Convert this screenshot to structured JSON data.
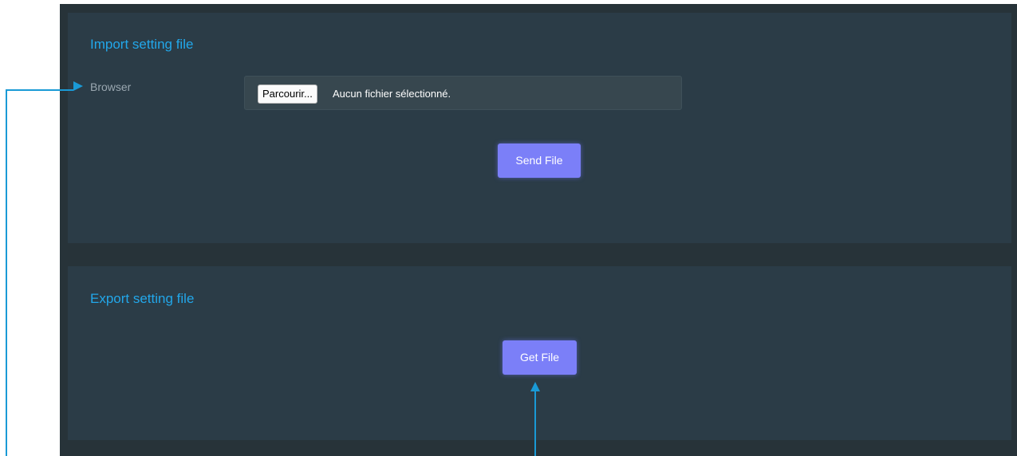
{
  "import_section": {
    "title": "Import setting file",
    "field_label": "Browser",
    "file_button_label": "Parcourir...",
    "file_status": "Aucun fichier sélectionné.",
    "send_button_label": "Send File"
  },
  "export_section": {
    "title": "Export setting file",
    "get_button_label": "Get File"
  },
  "annotation": {
    "color": "#1a9ad6"
  }
}
